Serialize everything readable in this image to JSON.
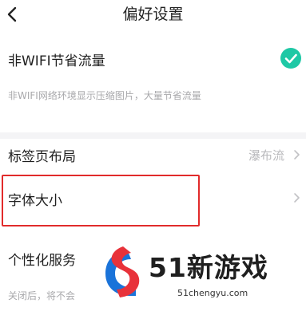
{
  "header": {
    "title": "偏好设置",
    "back_icon": "chevron-left-icon"
  },
  "settings": {
    "wifi_saver": {
      "label": "非WIFI节省流量",
      "description": "非WIFI网络环境显示压缩图片，大量节省流量",
      "checked": true,
      "check_color": "#1ec8a5"
    },
    "tab_layout": {
      "label": "标签页布局",
      "value": "瀑布流"
    },
    "font_size": {
      "label": "字体大小"
    },
    "personalization": {
      "label": "个性化服务",
      "description": "关闭后，将不会"
    }
  },
  "highlight_color": "#e12b2b",
  "watermark": {
    "brand": "51新游戏",
    "url": "51chengyu.com",
    "colors": {
      "red": "#e8323a",
      "blue": "#1a73d9"
    }
  }
}
